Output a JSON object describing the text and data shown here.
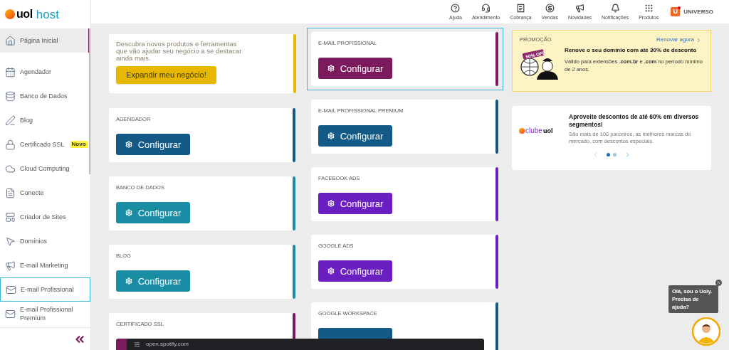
{
  "logo": {
    "brand": "uol",
    "product": "host"
  },
  "sidebar": {
    "items": [
      {
        "label": "Página Inicial",
        "selected": true,
        "highlighted": false
      },
      {
        "label": "Agendador",
        "selected": false,
        "highlighted": false
      },
      {
        "label": "Banco de Dados",
        "selected": false,
        "highlighted": false
      },
      {
        "label": "Blog",
        "selected": false,
        "highlighted": false
      },
      {
        "label": "Certificado SSL",
        "selected": false,
        "highlighted": false,
        "badge": "Novo"
      },
      {
        "label": "Cloud Computing",
        "selected": false,
        "highlighted": false
      },
      {
        "label": "Conecte",
        "selected": false,
        "highlighted": false
      },
      {
        "label": "Criador de Sites",
        "selected": false,
        "highlighted": false
      },
      {
        "label": "Domínios",
        "selected": false,
        "highlighted": false
      },
      {
        "label": "E-mail Marketing",
        "selected": false,
        "highlighted": false
      },
      {
        "label": "E-mail Profissional",
        "selected": false,
        "highlighted": true
      },
      {
        "label": "E-mail Profissional Premium",
        "selected": false,
        "highlighted": false
      }
    ]
  },
  "topbar": {
    "items": [
      {
        "label": "Ajuda"
      },
      {
        "label": "Atendimento"
      },
      {
        "label": "Cobrança"
      },
      {
        "label": "Vendas"
      },
      {
        "label": "Novidades"
      },
      {
        "label": "Notificações"
      },
      {
        "label": "Produtos"
      }
    ],
    "account": {
      "letter": "U",
      "name": "UNIVERSO"
    }
  },
  "intro_card": {
    "text": "Descubra novos produtos e ferramentas que vão ajudar seu negócio a se destacar ainda mais.",
    "button": "Expandir meu negócio!",
    "color": "#e8b800"
  },
  "columns": [
    [
      {
        "title": "AGENDADOR",
        "button": "Configurar",
        "color": "#145a86",
        "selected": false
      },
      {
        "title": "BANCO DE DADOS",
        "button": "Configurar",
        "color": "#1a8ca3",
        "selected": false
      },
      {
        "title": "BLOG",
        "button": "Configurar",
        "color": "#1a8ca3",
        "selected": false
      },
      {
        "title": "CERTIFICADO SSL",
        "color": "#7c1a5e",
        "selected": false
      }
    ],
    [
      {
        "title": "E-MAIL PROFISSIONAL",
        "button": "Configurar",
        "color": "#7c1a5e",
        "selected": true
      },
      {
        "title": "E-MAIL PROFISSIONAL PREMIUM",
        "button": "Configurar",
        "color": "#145a86",
        "selected": false
      },
      {
        "title": "FACEBOOK ADS",
        "button": "Configurar",
        "color": "#6a1fc2",
        "selected": false
      },
      {
        "title": "GOOGLE ADS",
        "button": "Configurar",
        "color": "#6a1fc2",
        "selected": false
      },
      {
        "title": "GOOGLE WORKSPACE",
        "color": "#145a86",
        "selected": false
      }
    ]
  ],
  "promo": {
    "label": "PROMOÇÃO",
    "link": "Renovar agora",
    "tag": "50% OFF",
    "title": "Renove o seu domínio com até 30% de desconto",
    "text": "Válido para extensões **.com.br** e **.com** no período mínimo de 2 anos."
  },
  "club": {
    "logo_word": "clube",
    "logo_brand": "uol",
    "title": "Aproveite descontos de até 60% em diversos segmentos!",
    "text": "São mais de 100 parceiros, as melhores marcas do mercado, com descontos especiais.",
    "dots": [
      {
        "selected": true
      },
      {
        "selected": false
      }
    ]
  },
  "chat": {
    "message": "Olá, sou o Uoly. Precisa de ajuda?"
  },
  "status_bar": {
    "url": "open.spotify.com"
  }
}
